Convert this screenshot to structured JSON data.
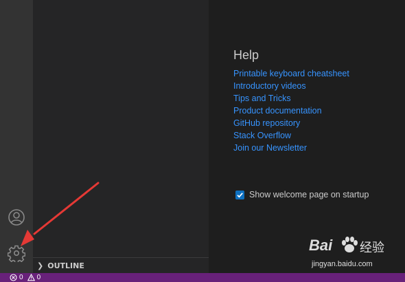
{
  "help": {
    "title": "Help",
    "links": [
      "Printable keyboard cheatsheet",
      "Introductory videos",
      "Tips and Tricks",
      "Product documentation",
      "GitHub repository",
      "Stack Overflow",
      "Join our Newsletter"
    ]
  },
  "startup": {
    "label": "Show welcome page on startup",
    "checked": true
  },
  "sidebar": {
    "outline_label": "OUTLINE"
  },
  "status": {
    "errors": "0",
    "warnings": "0"
  },
  "activity_bar": {
    "icons": [
      "account-icon",
      "gear-icon"
    ]
  },
  "watermark": {
    "brand": "Bai",
    "brand_suffix": "经验",
    "url": "jingyan.baidu.com"
  },
  "colors": {
    "link": "#3794ff",
    "status_bar": "#68217a",
    "annotation_arrow": "#e53935"
  }
}
